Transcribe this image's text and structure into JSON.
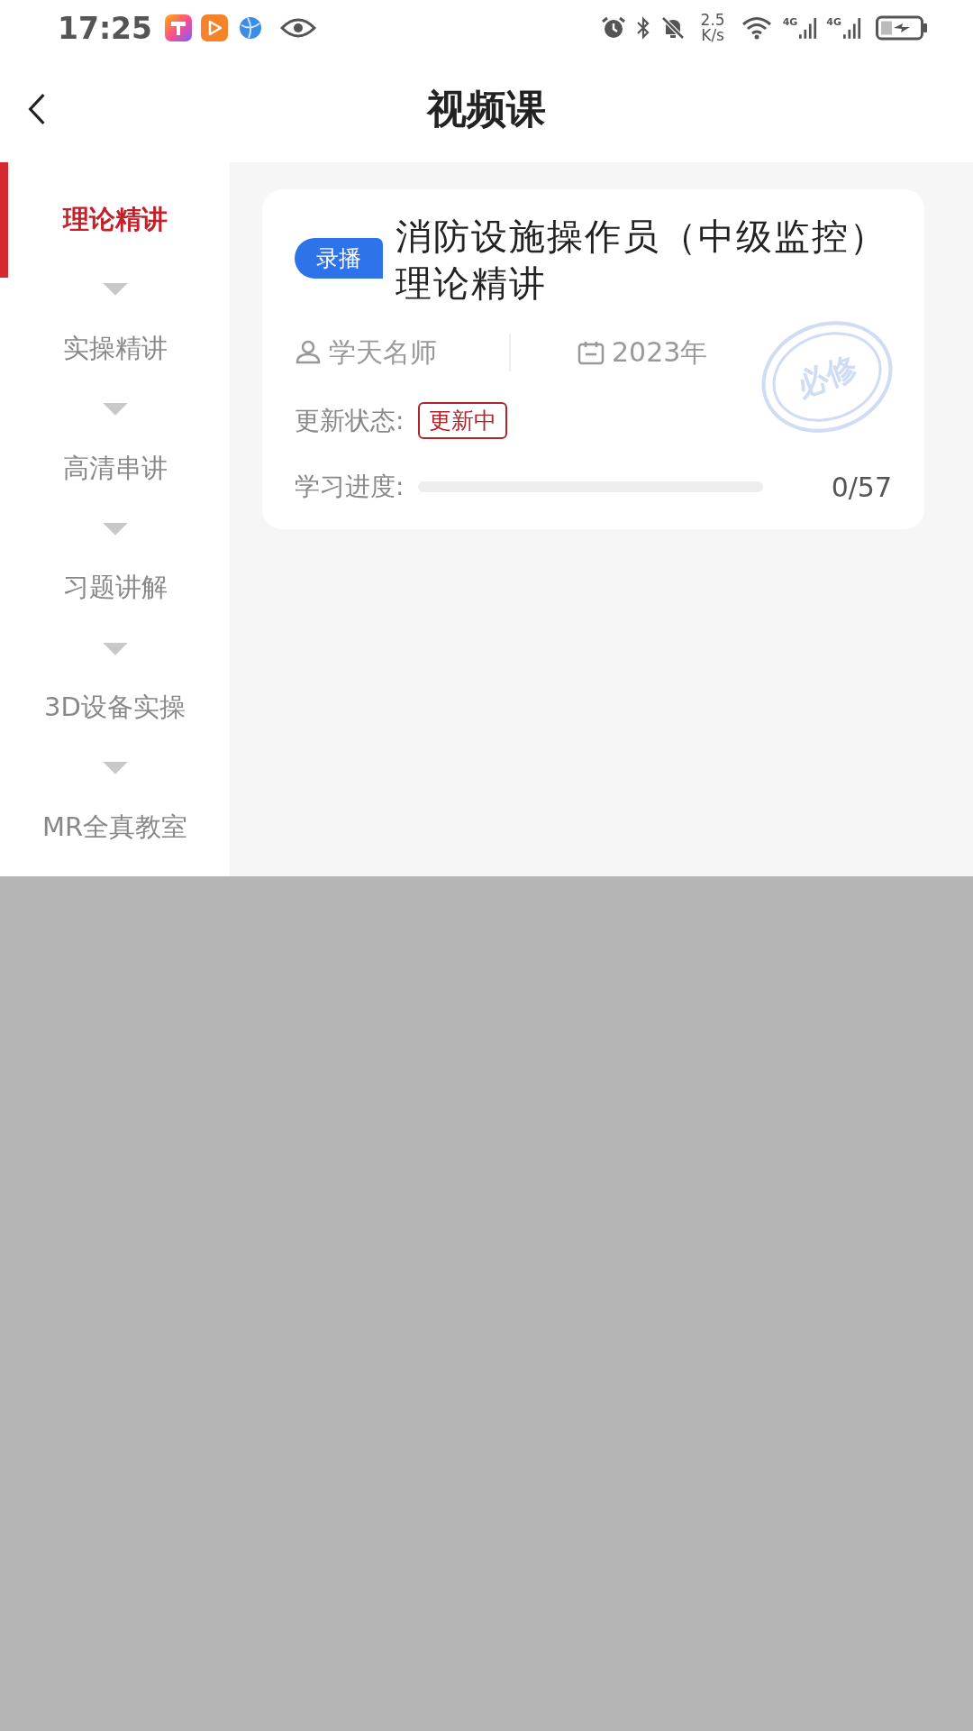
{
  "status_bar": {
    "time": "17:25",
    "network_speed_value": "2.5",
    "network_speed_unit": "K/s",
    "signal_label_1": "4G",
    "signal_label_2": "4G"
  },
  "header": {
    "title": "视频课"
  },
  "sidebar": {
    "items": [
      {
        "label": "理论精讲",
        "selected": true
      },
      {
        "label": "实操精讲",
        "selected": false
      },
      {
        "label": "高清串讲",
        "selected": false
      },
      {
        "label": "习题讲解",
        "selected": false
      },
      {
        "label": "3D设备实操",
        "selected": false
      },
      {
        "label": "MR全真教室",
        "selected": false
      }
    ]
  },
  "course": {
    "badge": "录播",
    "title": "消防设施操作员（中级监控）理论精讲",
    "teacher": "学天名师",
    "year": "2023年",
    "stamp": "必修",
    "status_label": "更新状态:",
    "status": "更新中",
    "progress_label": "学习进度:",
    "progress": {
      "level": 0
    },
    "progress_text": "0/57"
  }
}
